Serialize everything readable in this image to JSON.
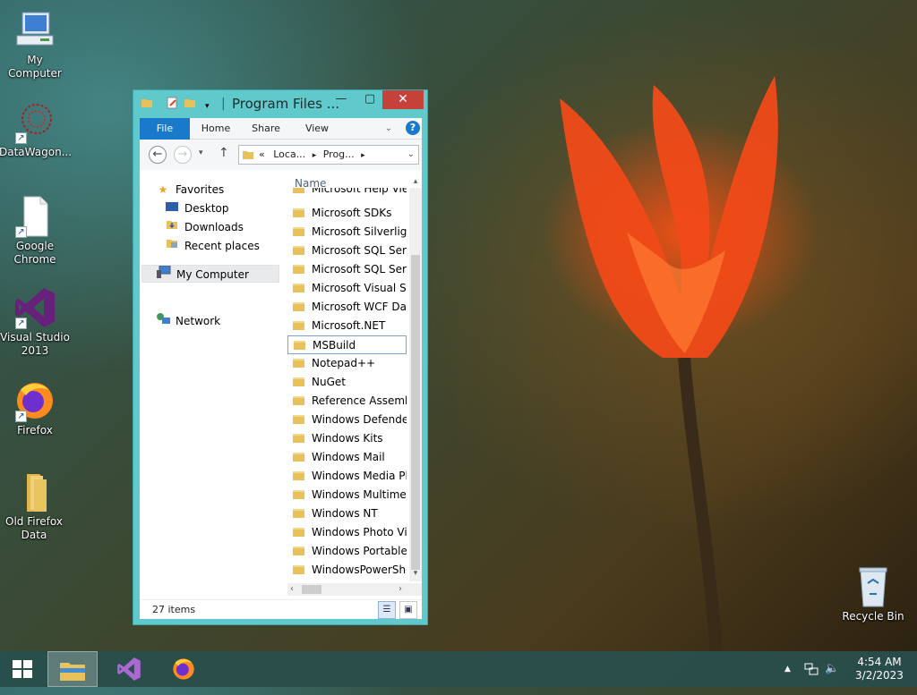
{
  "desktop": {
    "icons": [
      {
        "label": "My Computer",
        "icon": "computer-icon"
      },
      {
        "label": "DataWagon...",
        "icon": "datawagon-icon"
      },
      {
        "label": "Google Chrome",
        "icon": "blank-document-icon"
      },
      {
        "label": "Visual Studio 2013",
        "icon": "visual-studio-icon"
      },
      {
        "label": "Firefox",
        "icon": "firefox-icon"
      },
      {
        "label": "Old Firefox Data",
        "icon": "folder-icon"
      },
      {
        "label": "Recycle Bin",
        "icon": "recycle-bin-icon"
      }
    ]
  },
  "explorer": {
    "title": "Program Files ...",
    "close_glyph": "✕",
    "maximize_glyph": "▢",
    "minimize_glyph": "—",
    "ribbon_tabs": [
      "File",
      "Home",
      "Share",
      "View"
    ],
    "help_glyph": "?",
    "address": {
      "prefix": "«",
      "parts": [
        "Loca...",
        "Prog..."
      ]
    },
    "nav_pane": {
      "favorites": "Favorites",
      "desktop": "Desktop",
      "downloads": "Downloads",
      "recent": "Recent places",
      "computer": "My Computer",
      "network": "Network"
    },
    "column_header": "Name",
    "files": [
      "Microsoft Help Vie",
      "Microsoft SDKs",
      "Microsoft Silverligh",
      "Microsoft SQL Serv",
      "Microsoft SQL Serv",
      "Microsoft Visual St",
      "Microsoft WCF Dat",
      "Microsoft.NET",
      "MSBuild",
      "Notepad++",
      "NuGet",
      "Reference Assembl",
      "Windows Defender",
      "Windows Kits",
      "Windows Mail",
      "Windows Media Pl",
      "Windows Multimed",
      "Windows NT",
      "Windows Photo Vi",
      "Windows Portable",
      "WindowsPowerShe"
    ],
    "selected_file": "MSBuild",
    "status": "27 items"
  },
  "taskbar": {
    "clock_time": "4:54 AM",
    "clock_date": "3/2/2023"
  }
}
